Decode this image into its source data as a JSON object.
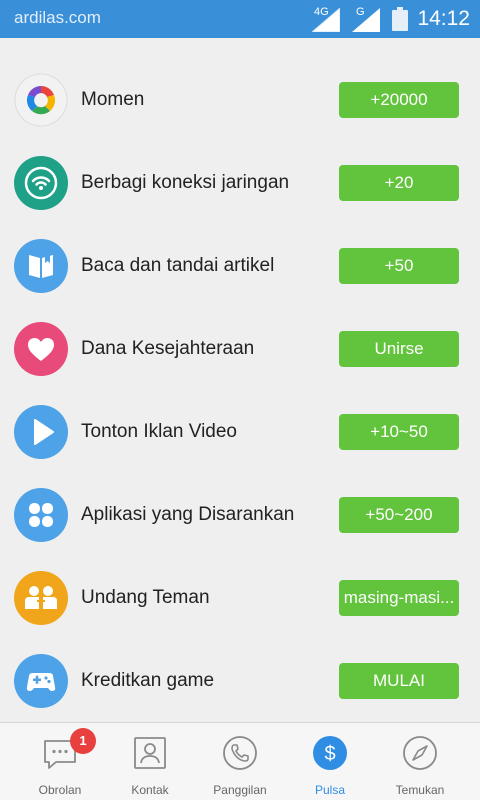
{
  "status_bar": {
    "site": "ardilas.com",
    "network_1": "4G",
    "network_2": "G",
    "time": "14:12"
  },
  "items": [
    {
      "label": "Momen",
      "button": "+20000",
      "icon": "momen-colorful-ring-icon",
      "icon_color": "#f2f2f2"
    },
    {
      "label": "Berbagi koneksi jaringan",
      "button": "+20",
      "icon": "wifi-icon",
      "icon_color": "#1fa187"
    },
    {
      "label": "Baca dan tandai artikel",
      "button": "+50",
      "icon": "book-icon",
      "icon_color": "#4da2e8"
    },
    {
      "label": "Dana Kesejahteraan",
      "button": "Unirse",
      "icon": "heart-icon",
      "icon_color": "#e84a7a"
    },
    {
      "label": "Tonton Iklan Video",
      "button": "+10~50",
      "icon": "play-icon",
      "icon_color": "#4da2e8"
    },
    {
      "label": "Aplikasi yang Disarankan",
      "button": "+50~200",
      "icon": "apps-icon",
      "icon_color": "#4da2e8"
    },
    {
      "label": "Undang Teman",
      "button": "masing-masi...",
      "icon": "friends-icon",
      "icon_color": "#f0a51a"
    },
    {
      "label": "Kreditkan game",
      "button": "MULAI",
      "icon": "gamepad-icon",
      "icon_color": "#4da2e8"
    }
  ],
  "colors": {
    "status_bar": "#3a8fd9",
    "button": "#62c43c",
    "active_tab": "#2f8de4",
    "badge": "#e83f3f"
  },
  "tabs": [
    {
      "label": "Obrolan",
      "icon": "chat-icon",
      "badge": "1"
    },
    {
      "label": "Kontak",
      "icon": "contact-icon"
    },
    {
      "label": "Panggilan",
      "icon": "phone-icon"
    },
    {
      "label": "Pulsa",
      "icon": "dollar-icon",
      "active": true
    },
    {
      "label": "Temukan",
      "icon": "compass-icon"
    }
  ]
}
